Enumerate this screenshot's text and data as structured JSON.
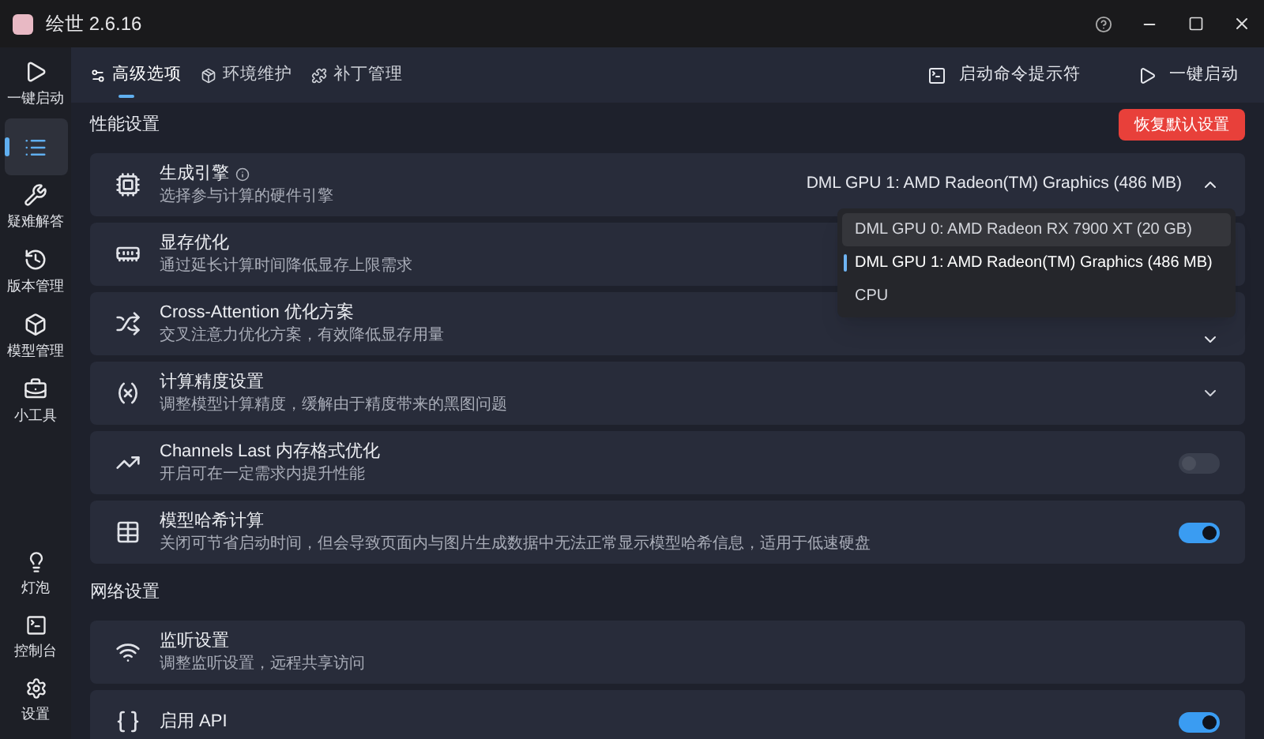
{
  "window": {
    "title": "绘世 2.6.16"
  },
  "sidebar": {
    "items": [
      {
        "label": "一键启动",
        "selected": false
      },
      {
        "selected": true
      },
      {
        "label": "疑难解答",
        "selected": false
      },
      {
        "label": "版本管理",
        "selected": false
      },
      {
        "label": "模型管理",
        "selected": false
      },
      {
        "label": "小工具",
        "selected": false
      }
    ],
    "bottom_items": [
      {
        "label": "灯泡"
      },
      {
        "label": "控制台"
      },
      {
        "label": "设置"
      }
    ]
  },
  "tabs": [
    {
      "label": "高级选项",
      "selected": true
    },
    {
      "label": "环境维护",
      "selected": false
    },
    {
      "label": "补丁管理",
      "selected": false
    }
  ],
  "toolbar": [
    {
      "label": "启动命令提示符"
    },
    {
      "label": "一键启动"
    }
  ],
  "sections": [
    {
      "title": "性能设置",
      "action": "恢复默认设置",
      "rows": [
        {
          "kind": "dropdown",
          "title": "生成引擎",
          "subtitle": "选择参与计算的硬件引擎",
          "value": "DML GPU 1: AMD Radeon(TM) Graphics (486 MB)",
          "expanded": true,
          "options": [
            {
              "label": "DML GPU 0: AMD Radeon RX 7900 XT (20 GB)",
              "selected": false
            },
            {
              "label": "DML GPU 1: AMD Radeon(TM) Graphics (486 MB)",
              "selected": true
            },
            {
              "label": "CPU",
              "selected": false
            }
          ]
        },
        {
          "kind": "plain",
          "title": "显存优化",
          "subtitle": "通过延长计算时间降低显存上限需求"
        },
        {
          "kind": "dropdown",
          "title": "Cross-Attention 优化方案",
          "subtitle": "交叉注意力优化方案，有效降低显存用量",
          "expanded": false
        },
        {
          "kind": "expand",
          "title": "计算精度设置",
          "subtitle": "调整模型计算精度，缓解由于精度带来的黑图问题",
          "expanded": false
        },
        {
          "kind": "toggle",
          "title": "Channels Last 内存格式优化",
          "subtitle": "开启可在一定需求内提升性能",
          "on": false,
          "disabled": true
        },
        {
          "kind": "toggle",
          "title": "模型哈希计算",
          "subtitle": "关闭可节省启动时间，但会导致页面内与图片生成数据中无法正常显示模型哈希信息，适用于低速硬盘",
          "on": true,
          "disabled": false
        }
      ]
    },
    {
      "title": "网络设置",
      "rows": [
        {
          "kind": "plain",
          "title": "监听设置",
          "subtitle": "调整监听设置，远程共享访问"
        },
        {
          "kind": "toggle",
          "title": "启用 API",
          "on": true,
          "disabled": false
        }
      ]
    }
  ]
}
